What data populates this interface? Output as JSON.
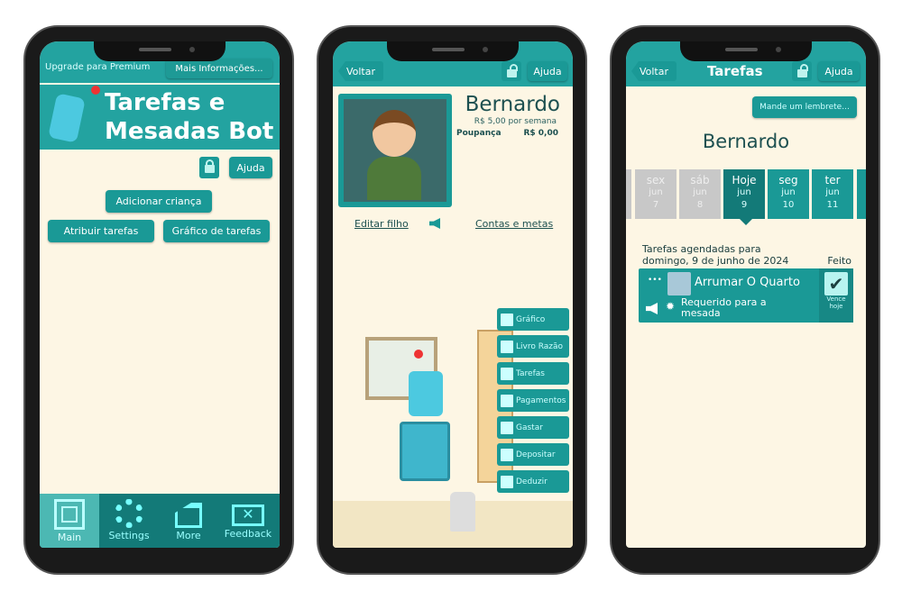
{
  "colors": {
    "teal": "#1a9996",
    "header": "#23a3a0",
    "background": "#fdf6e4",
    "dark_text": "#1d5050"
  },
  "screen1": {
    "upgrade_text": "Upgrade para Premium",
    "more_info_button": "Mais Informações...",
    "app_title_line1": "Tarefas e",
    "app_title_line2": "Mesadas Bot",
    "help_button": "Ajuda",
    "add_child_button": "Adicionar criança",
    "assign_chores_button": "Atribuir tarefas",
    "chore_chart_button": "Gráfico de tarefas",
    "bottom_nav": [
      {
        "label": "Main",
        "icon": "safe-icon",
        "active": true
      },
      {
        "label": "Settings",
        "icon": "gear-icon"
      },
      {
        "label": "More",
        "icon": "cake-icon"
      },
      {
        "label": "Feedback",
        "icon": "envelope-icon"
      }
    ]
  },
  "screen2": {
    "back_button": "Voltar",
    "help_button": "Ajuda",
    "child_name": "Bernardo",
    "allowance": "R$ 5,00 por semana",
    "savings_label": "Poupança",
    "savings_value": "R$ 0,00",
    "edit_child_link": "Editar filho",
    "accounts_link": "Contas e metas",
    "side_menu": [
      {
        "label": "Gráfico",
        "icon": "chart-icon"
      },
      {
        "label": "Livro Razão",
        "icon": "ledger-icon"
      },
      {
        "label": "Tarefas",
        "icon": "cup-icon"
      },
      {
        "label": "Pagamentos",
        "icon": "checkbox-icon"
      },
      {
        "label": "Gastar",
        "icon": "coins-icon"
      },
      {
        "label": "Depositar",
        "icon": "arrow-up-icon"
      },
      {
        "label": "Deduzir",
        "icon": "arrow-down-icon"
      }
    ]
  },
  "screen3": {
    "back_button": "Voltar",
    "title": "Tarefas",
    "help_button": "Ajuda",
    "reminder_button": "Mande um lembrete...",
    "child_name": "Bernardo",
    "days": [
      {
        "weekday": "sex",
        "month": "jun",
        "day": "7",
        "past": true
      },
      {
        "weekday": "sáb",
        "month": "jun",
        "day": "8",
        "past": true
      },
      {
        "weekday": "Hoje",
        "month": "jun",
        "day": "9",
        "selected": true
      },
      {
        "weekday": "seg",
        "month": "jun",
        "day": "10"
      },
      {
        "weekday": "ter",
        "month": "jun",
        "day": "11"
      }
    ],
    "scheduled_line1": "Tarefas agendadas para",
    "scheduled_line2": "domingo, 9 de junho de 2024",
    "done_header": "Feito",
    "chore": {
      "name": "Arrumar O Quarto",
      "note": "Requerido para a mesada",
      "due": "Vence hoje",
      "more": "•••",
      "done": true
    }
  }
}
